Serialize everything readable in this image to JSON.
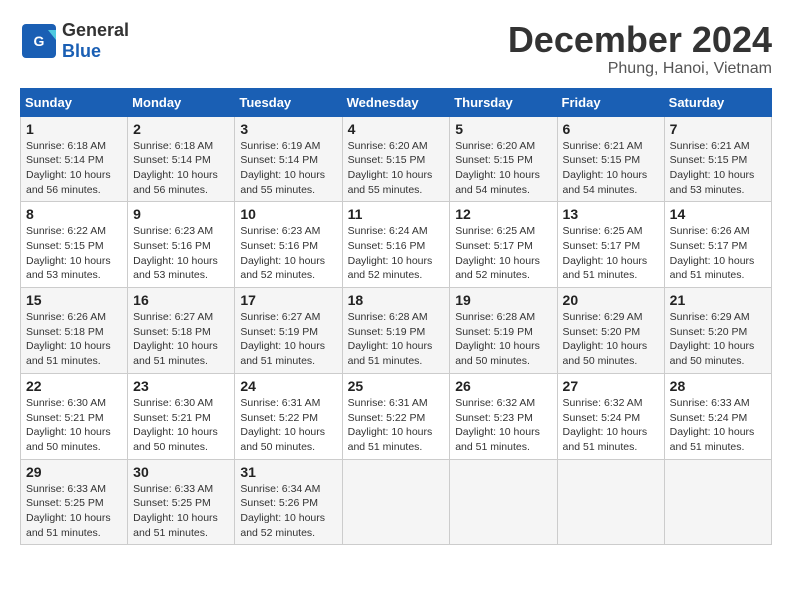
{
  "header": {
    "logo_line1": "General",
    "logo_line2": "Blue",
    "month_title": "December 2024",
    "location": "Phung, Hanoi, Vietnam"
  },
  "weekdays": [
    "Sunday",
    "Monday",
    "Tuesday",
    "Wednesday",
    "Thursday",
    "Friday",
    "Saturday"
  ],
  "weeks": [
    [
      {
        "day": "1",
        "sunrise": "6:18 AM",
        "sunset": "5:14 PM",
        "daylight": "10 hours and 56 minutes."
      },
      {
        "day": "2",
        "sunrise": "6:18 AM",
        "sunset": "5:14 PM",
        "daylight": "10 hours and 56 minutes."
      },
      {
        "day": "3",
        "sunrise": "6:19 AM",
        "sunset": "5:14 PM",
        "daylight": "10 hours and 55 minutes."
      },
      {
        "day": "4",
        "sunrise": "6:20 AM",
        "sunset": "5:15 PM",
        "daylight": "10 hours and 55 minutes."
      },
      {
        "day": "5",
        "sunrise": "6:20 AM",
        "sunset": "5:15 PM",
        "daylight": "10 hours and 54 minutes."
      },
      {
        "day": "6",
        "sunrise": "6:21 AM",
        "sunset": "5:15 PM",
        "daylight": "10 hours and 54 minutes."
      },
      {
        "day": "7",
        "sunrise": "6:21 AM",
        "sunset": "5:15 PM",
        "daylight": "10 hours and 53 minutes."
      }
    ],
    [
      {
        "day": "8",
        "sunrise": "6:22 AM",
        "sunset": "5:15 PM",
        "daylight": "10 hours and 53 minutes."
      },
      {
        "day": "9",
        "sunrise": "6:23 AM",
        "sunset": "5:16 PM",
        "daylight": "10 hours and 53 minutes."
      },
      {
        "day": "10",
        "sunrise": "6:23 AM",
        "sunset": "5:16 PM",
        "daylight": "10 hours and 52 minutes."
      },
      {
        "day": "11",
        "sunrise": "6:24 AM",
        "sunset": "5:16 PM",
        "daylight": "10 hours and 52 minutes."
      },
      {
        "day": "12",
        "sunrise": "6:25 AM",
        "sunset": "5:17 PM",
        "daylight": "10 hours and 52 minutes."
      },
      {
        "day": "13",
        "sunrise": "6:25 AM",
        "sunset": "5:17 PM",
        "daylight": "10 hours and 51 minutes."
      },
      {
        "day": "14",
        "sunrise": "6:26 AM",
        "sunset": "5:17 PM",
        "daylight": "10 hours and 51 minutes."
      }
    ],
    [
      {
        "day": "15",
        "sunrise": "6:26 AM",
        "sunset": "5:18 PM",
        "daylight": "10 hours and 51 minutes."
      },
      {
        "day": "16",
        "sunrise": "6:27 AM",
        "sunset": "5:18 PM",
        "daylight": "10 hours and 51 minutes."
      },
      {
        "day": "17",
        "sunrise": "6:27 AM",
        "sunset": "5:19 PM",
        "daylight": "10 hours and 51 minutes."
      },
      {
        "day": "18",
        "sunrise": "6:28 AM",
        "sunset": "5:19 PM",
        "daylight": "10 hours and 51 minutes."
      },
      {
        "day": "19",
        "sunrise": "6:28 AM",
        "sunset": "5:19 PM",
        "daylight": "10 hours and 50 minutes."
      },
      {
        "day": "20",
        "sunrise": "6:29 AM",
        "sunset": "5:20 PM",
        "daylight": "10 hours and 50 minutes."
      },
      {
        "day": "21",
        "sunrise": "6:29 AM",
        "sunset": "5:20 PM",
        "daylight": "10 hours and 50 minutes."
      }
    ],
    [
      {
        "day": "22",
        "sunrise": "6:30 AM",
        "sunset": "5:21 PM",
        "daylight": "10 hours and 50 minutes."
      },
      {
        "day": "23",
        "sunrise": "6:30 AM",
        "sunset": "5:21 PM",
        "daylight": "10 hours and 50 minutes."
      },
      {
        "day": "24",
        "sunrise": "6:31 AM",
        "sunset": "5:22 PM",
        "daylight": "10 hours and 50 minutes."
      },
      {
        "day": "25",
        "sunrise": "6:31 AM",
        "sunset": "5:22 PM",
        "daylight": "10 hours and 51 minutes."
      },
      {
        "day": "26",
        "sunrise": "6:32 AM",
        "sunset": "5:23 PM",
        "daylight": "10 hours and 51 minutes."
      },
      {
        "day": "27",
        "sunrise": "6:32 AM",
        "sunset": "5:24 PM",
        "daylight": "10 hours and 51 minutes."
      },
      {
        "day": "28",
        "sunrise": "6:33 AM",
        "sunset": "5:24 PM",
        "daylight": "10 hours and 51 minutes."
      }
    ],
    [
      {
        "day": "29",
        "sunrise": "6:33 AM",
        "sunset": "5:25 PM",
        "daylight": "10 hours and 51 minutes."
      },
      {
        "day": "30",
        "sunrise": "6:33 AM",
        "sunset": "5:25 PM",
        "daylight": "10 hours and 51 minutes."
      },
      {
        "day": "31",
        "sunrise": "6:34 AM",
        "sunset": "5:26 PM",
        "daylight": "10 hours and 52 minutes."
      },
      null,
      null,
      null,
      null
    ]
  ]
}
